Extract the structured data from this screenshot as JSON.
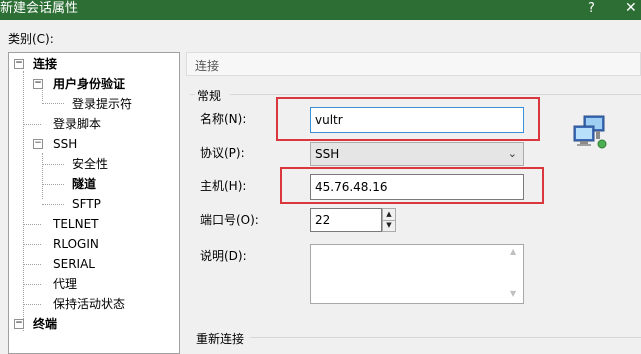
{
  "window": {
    "title": "新建会话属性",
    "help_glyph": "?",
    "close_glyph": "✕"
  },
  "category_label": "类别(C):",
  "tree": {
    "items": [
      {
        "label": "连接",
        "expander": "−"
      },
      {
        "label": "用户身份验证",
        "expander": "−"
      },
      {
        "label": "登录提示符"
      },
      {
        "label": "登录脚本"
      },
      {
        "label": "SSH",
        "expander": "−"
      },
      {
        "label": "安全性"
      },
      {
        "label": "隧道"
      },
      {
        "label": "SFTP"
      },
      {
        "label": "TELNET"
      },
      {
        "label": "RLOGIN"
      },
      {
        "label": "SERIAL"
      },
      {
        "label": "代理"
      },
      {
        "label": "保持活动状态"
      },
      {
        "label": "终端",
        "expander": "−"
      }
    ]
  },
  "section": {
    "header": "连接"
  },
  "general": {
    "group_title": "常规",
    "name": {
      "label": "名称(N):",
      "value": "vultr"
    },
    "protocol": {
      "label": "协议(P):",
      "value": "SSH"
    },
    "host": {
      "label": "主机(H):",
      "value": "45.76.48.16"
    },
    "port": {
      "label": "端口号(O):",
      "value": "22"
    },
    "description": {
      "label": "说明(D):",
      "value": ""
    }
  },
  "reconnect": {
    "group_title": "重新连接"
  },
  "icons": {
    "computer": "network-computers-icon",
    "expander": "tree-expander-icon"
  },
  "colors": {
    "titlebar": "#2c6e34",
    "highlight": "#d9363e",
    "focus": "#3c8fd6"
  }
}
